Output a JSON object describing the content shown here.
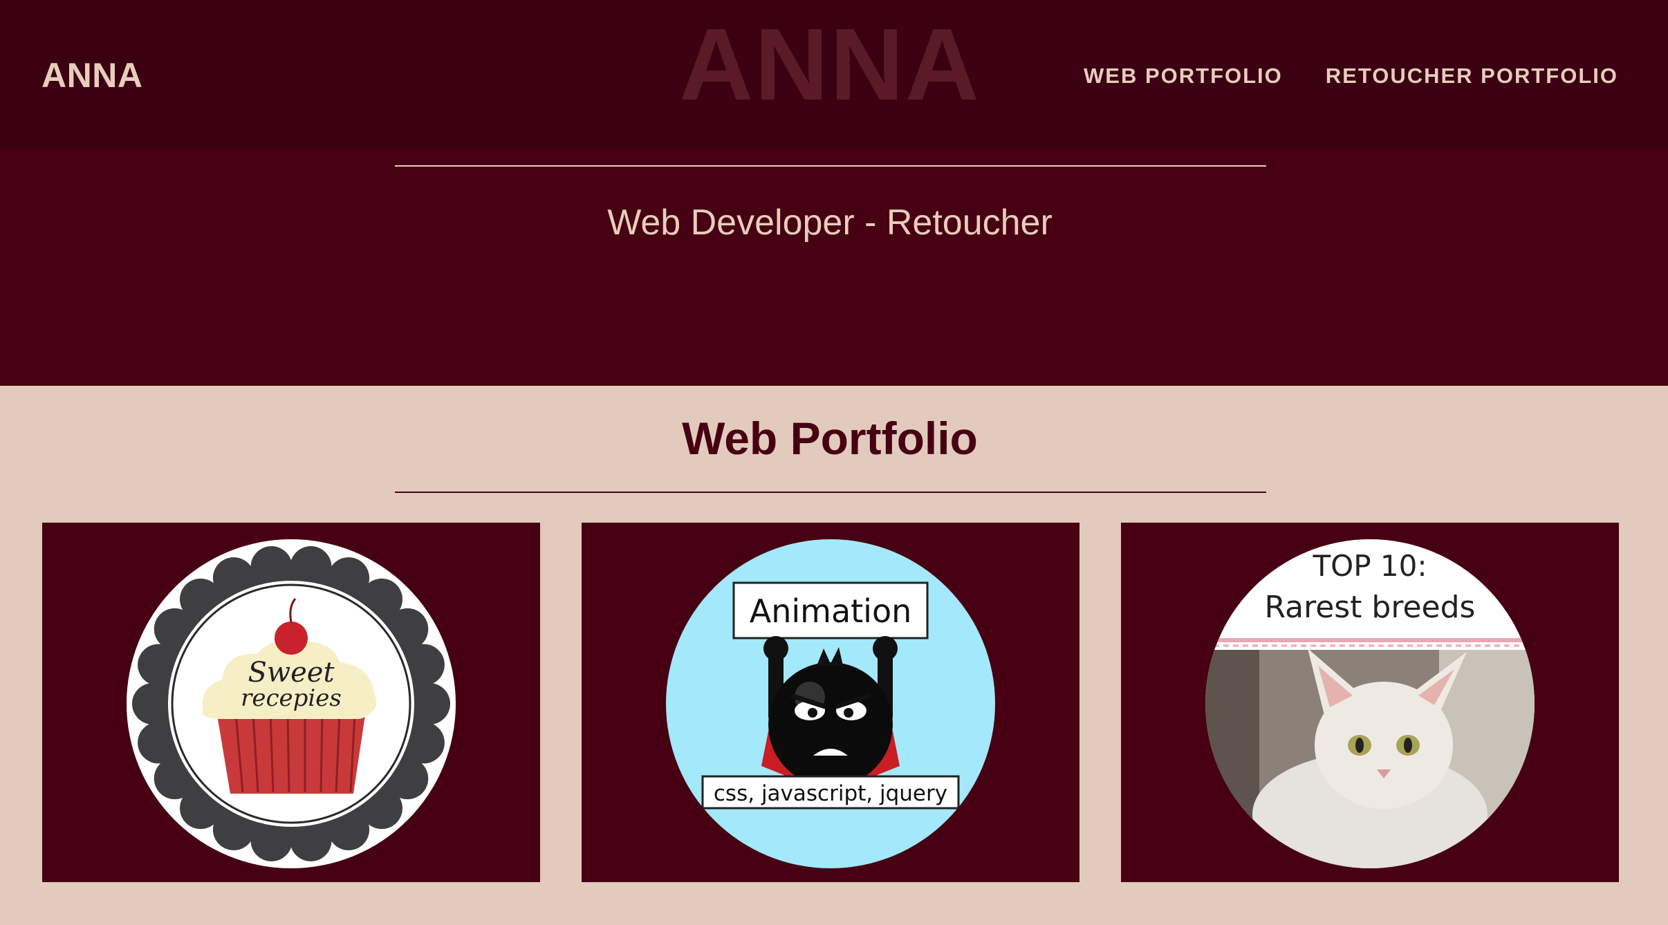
{
  "navbar": {
    "brand": "ANNA",
    "hero_name": "ANNA",
    "links": [
      "WEB PORTFOLIO",
      "RETOUCHER PORTFOLIO"
    ]
  },
  "hero": {
    "subtitle": "Web Developer - Retoucher"
  },
  "portfolio": {
    "title": "Web Portfolio",
    "items": [
      {
        "icon": "cupcake-logo",
        "label_line1": "Sweet",
        "label_line2": "recepies"
      },
      {
        "icon": "angry-bomb-logo",
        "label_top": "Animation",
        "label_bottom": "css, javascript, jquery"
      },
      {
        "icon": "cat-photo",
        "label_line1": "TOP 10:",
        "label_line2": "Rarest breeds"
      }
    ]
  },
  "colors": {
    "dark_maroon": "#470013",
    "navbar_maroon": "#3b0012",
    "beige": "#e2cbbd",
    "light_text": "#e8cdbb",
    "animation_bg": "#a3e8fb"
  }
}
